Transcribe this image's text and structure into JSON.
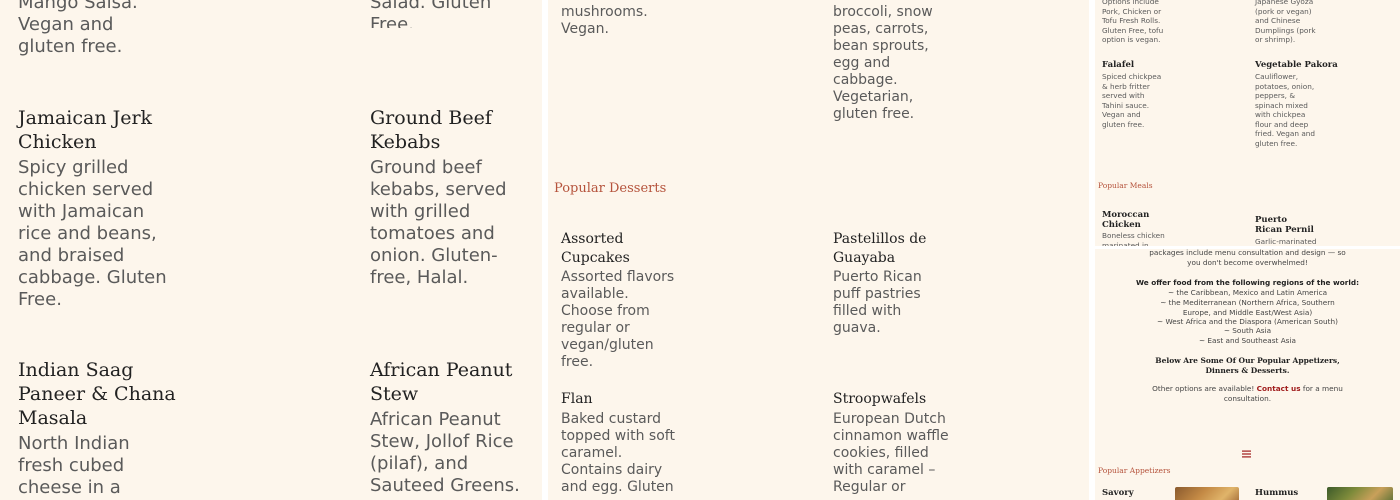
{
  "panel1": {
    "items": [
      {
        "title": "",
        "desc": "Mango Salsa. Vegan and gluten free."
      },
      {
        "title": "",
        "desc": "Salad. Gluten Free."
      },
      {
        "title": "Jamaican Jerk Chicken",
        "desc": "Spicy grilled chicken served with Jamaican rice and beans, and braised cabbage. Gluten Free."
      },
      {
        "title": "Ground Beef Kebabs",
        "desc": "Ground beef kebabs, served with grilled tomatoes and onion. Gluten-free, Halal."
      },
      {
        "title": "Indian Saag Paneer & Chana Masala",
        "desc": "North Indian fresh cubed cheese in a"
      },
      {
        "title": "African Peanut Stew",
        "desc": "African Peanut Stew, Jollof Rice (pilaf), and Sauteed Greens."
      }
    ]
  },
  "panel2": {
    "top_left": "mushrooms. Vegan.",
    "top_right": "broccoli, snow peas, carrots, bean sprouts, egg and cabbage. Vegetarian, gluten free.",
    "section_heading": "Popular Desserts",
    "items": [
      {
        "title": "Assorted Cupcakes",
        "desc": "Assorted flavors available. Choose from regular or vegan/gluten free."
      },
      {
        "title": "Pastelillos de Guayaba",
        "desc": "Puerto Rican puff pastries filled with guava."
      },
      {
        "title": "Flan",
        "desc": "Baked custard topped with soft caramel. Contains dairy and egg. Gluten"
      },
      {
        "title": "Stroopwafels",
        "desc": "European Dutch cinnamon waffle cookies, filled with caramel – Regular or"
      }
    ]
  },
  "panel3": {
    "top_left_desc": "Options include Pork, Chicken or Tofu Fresh Rolls. Gluten Free, tofu option is vegan.",
    "top_right_desc": "Japanese Gyoza (pork or vegan) and Chinese Dumplings (pork or shrimp).",
    "falafel": {
      "title": "Falafel",
      "desc": "Spiced chickpea & herb fritter served with Tahini sauce. Vegan and gluten free."
    },
    "pakora": {
      "title": "Vegetable Pakora",
      "desc": "Cauliflower, potatoes, onion, peppers, & spinach mixed with chickpea flour and deep fried. Vegan and gluten free."
    },
    "popular_meals_heading": "Popular Meals",
    "moroccan": {
      "title": "Moroccan Chicken",
      "desc": "Boneless chicken marinated in"
    },
    "pernil": {
      "title": "Puerto Rican Pernil",
      "desc": "Garlic-marinated"
    },
    "packages_text": "packages include menu consultation and design — so you don't become overwhelmed!",
    "regions_heading": "We offer food from the following regions of the world:",
    "regions": [
      "~ the Caribbean, Mexico and Latin America",
      "~ the Mediterranean (Northern Africa, Southern Europe, and Middle East/West Asia)",
      "~ West Africa and the Diaspora (American South)",
      "~ South Asia",
      "~ East and Southeast Asia"
    ],
    "below_heading": "Below Are Some Of Our Popular Appetizers, Dinners & Desserts.",
    "other_options_pre": "Other options are available!",
    "contact_link": "Contact us",
    "other_options_post": "for a menu consultation.",
    "menu_icon": "hamburger-menu-icon",
    "popular_appetizers_heading": "Popular Appetizers",
    "savory_title": "Savory",
    "hummus_title": "Hummus"
  },
  "colors": {
    "background": "#fdf6ec",
    "accent": "#b5533c",
    "link": "#a01c1c",
    "divider": "#ffffff"
  }
}
